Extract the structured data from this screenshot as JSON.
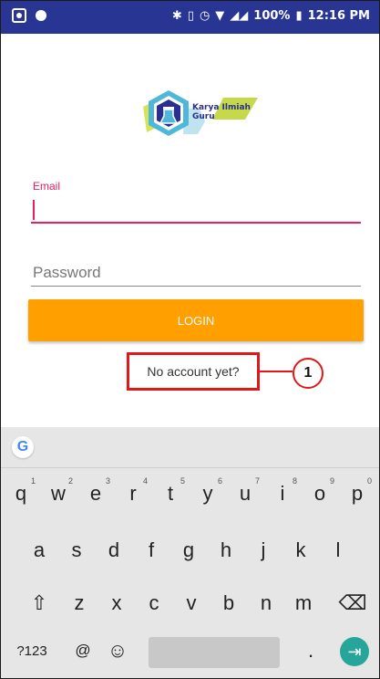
{
  "status_bar": {
    "battery": "100%",
    "time": "12:16 PM",
    "icons": [
      "notification-icon",
      "dot-icon",
      "bluetooth-icon",
      "vibrate-icon",
      "alarm-icon",
      "wifi-icon",
      "signal-icon",
      "battery-icon"
    ]
  },
  "logo": {
    "line1": "Karya Ilmiah",
    "line2": "Guru"
  },
  "form": {
    "email_label": "Email",
    "email_value": "",
    "password_placeholder": "Password",
    "login_label": "LOGIN",
    "no_account_label": "No account yet?"
  },
  "annotation": {
    "number": "1"
  },
  "colors": {
    "status_bar": "#283593",
    "accent": "#e91e63",
    "button": "#ffa000",
    "annotation": "#e01818",
    "enter_key": "#26a69a"
  },
  "keyboard": {
    "google_label": "G",
    "row1": [
      {
        "key": "q",
        "hint": "1"
      },
      {
        "key": "w",
        "hint": "2"
      },
      {
        "key": "e",
        "hint": "3"
      },
      {
        "key": "r",
        "hint": "4"
      },
      {
        "key": "t",
        "hint": "5"
      },
      {
        "key": "y",
        "hint": "6"
      },
      {
        "key": "u",
        "hint": "7"
      },
      {
        "key": "i",
        "hint": "8"
      },
      {
        "key": "o",
        "hint": "9"
      },
      {
        "key": "p",
        "hint": "0"
      }
    ],
    "row2": [
      "a",
      "s",
      "d",
      "f",
      "g",
      "h",
      "j",
      "k",
      "l"
    ],
    "row3": [
      "z",
      "x",
      "c",
      "v",
      "b",
      "n",
      "m"
    ],
    "symbols_label": "?123",
    "at_label": "@",
    "emoji_label": "☺",
    "period_label": "."
  }
}
